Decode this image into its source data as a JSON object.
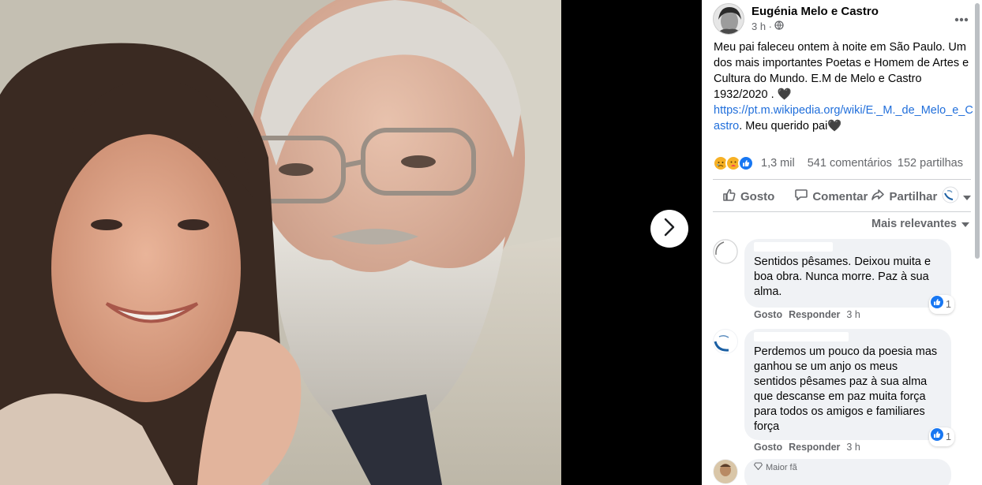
{
  "colors": {
    "link": "#216fdb",
    "secondary_text": "#65676b",
    "bubble": "#f0f2f5",
    "like_blue": "#1877f2"
  },
  "post": {
    "author": "Eugénia Melo e Castro",
    "time": "3 h ·",
    "text_main": "Meu pai faleceu ontem à noite em São Paulo. Um dos mais importantes Poetas e Homem de Artes e Cultura do Mundo. E.M de Melo e Castro 1932/2020 . 🖤",
    "link_text": "https://pt.m.wikipedia.org/wiki/E._M._de_Melo_e_Castro",
    "text_after_link": ". Meu querido pai🖤",
    "reactions_count": "1,3 mil",
    "comments_count": "541 comentários",
    "shares_count": "152 partilhas"
  },
  "actions": {
    "like": "Gosto",
    "comment": "Comentar",
    "share": "Partilhar"
  },
  "sort": {
    "label": "Mais relevantes"
  },
  "comments": [
    {
      "text": "Sentidos pêsames. Deixou muita e boa obra. Nunca morre. Paz à sua alma.",
      "like": "Gosto",
      "reply": "Responder",
      "time": "3 h",
      "reactions": "1"
    },
    {
      "text": "Perdemos um pouco da poesia mas ganhou se um anjo os meus sentidos pêsames paz à sua alma que descanse em paz muita força para todos os amigos e familiares força",
      "like": "Gosto",
      "reply": "Responder",
      "time": "3 h",
      "reactions": "1"
    }
  ],
  "badge": {
    "label": "Maior fã"
  }
}
